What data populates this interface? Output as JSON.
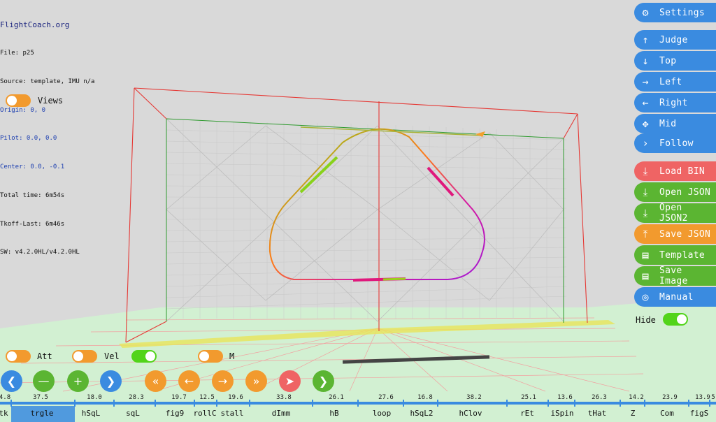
{
  "header": {
    "site": "FlightCoach.org",
    "lines": [
      "File: p25",
      "Source: template, IMU n/a",
      "Origin: 0, 0",
      "Pilot: 0.0, 0.0",
      "Center: 0.0, -0.1",
      "Total time: 6m54s",
      "Tkoff-Last: 6m46s",
      "SW: v4.2.0HL/v4.2.0HL"
    ]
  },
  "toggles": {
    "views": {
      "label": "Views",
      "state": "off"
    },
    "hide": {
      "label": "Hide",
      "state": "on"
    },
    "att": {
      "label": "Att",
      "state": "off"
    },
    "vel": {
      "label": "Vel",
      "state": "off"
    },
    "t3": {
      "label": "",
      "state": "on"
    },
    "m": {
      "label": "M",
      "state": "off"
    }
  },
  "side_buttons": [
    {
      "label": "Settings",
      "icon": "gear-icon",
      "glyph": "⚙",
      "color": "#3a8be0"
    },
    {
      "label": "Judge",
      "icon": "arrow-up-icon",
      "glyph": "↑",
      "color": "#3a8be0"
    },
    {
      "label": "Top",
      "icon": "arrow-down-icon",
      "glyph": "↓",
      "color": "#3a8be0"
    },
    {
      "label": "Left",
      "icon": "arrow-right-icon",
      "glyph": "→",
      "color": "#3a8be0"
    },
    {
      "label": "Right",
      "icon": "arrow-left-icon",
      "glyph": "←",
      "color": "#3a8be0"
    },
    {
      "label": "Mid",
      "icon": "move-icon",
      "glyph": "✥",
      "color": "#3a8be0"
    },
    {
      "label": "Follow",
      "icon": "chevron-right-icon",
      "glyph": "›",
      "color": "#3a8be0"
    },
    {
      "label": "Load BIN",
      "icon": "download-icon",
      "glyph": "⤓",
      "color": "#ef6464"
    },
    {
      "label": "Open JSON",
      "icon": "download-icon",
      "glyph": "⤓",
      "color": "#5bb532"
    },
    {
      "label": "Open JSON2",
      "icon": "download-icon",
      "glyph": "⤓",
      "color": "#5bb532"
    },
    {
      "label": "Save JSON",
      "icon": "upload-icon",
      "glyph": "⤒",
      "color": "#f29a2e"
    },
    {
      "label": "Template",
      "icon": "document-icon",
      "glyph": "▤",
      "color": "#5bb532"
    },
    {
      "label": "Save Image",
      "icon": "document-icon",
      "glyph": "▤",
      "color": "#5bb532"
    },
    {
      "label": "Manual",
      "icon": "lifebuoy-icon",
      "glyph": "◎",
      "color": "#3a8be0"
    }
  ],
  "controls": [
    {
      "name": "prev-button",
      "icon": "chevron-left-icon",
      "glyph": "❮",
      "color": "#3a8be0"
    },
    {
      "name": "zoom-out-button",
      "icon": "minus-icon",
      "glyph": "—",
      "color": "#5bb532"
    },
    {
      "name": "zoom-in-button",
      "icon": "plus-icon",
      "glyph": "+",
      "color": "#5bb532"
    },
    {
      "name": "next-button",
      "icon": "chevron-right-icon",
      "glyph": "❯",
      "color": "#3a8be0"
    },
    {
      "name": "rewind-fast-button",
      "icon": "double-chevron-left-icon",
      "glyph": "«",
      "color": "#f29a2e"
    },
    {
      "name": "step-back-button",
      "icon": "arrow-left-icon",
      "glyph": "←",
      "color": "#f29a2e"
    },
    {
      "name": "step-forward-button",
      "icon": "arrow-right-icon",
      "glyph": "→",
      "color": "#f29a2e"
    },
    {
      "name": "forward-fast-button",
      "icon": "double-chevron-right-icon",
      "glyph": "»",
      "color": "#f29a2e"
    },
    {
      "name": "send-button",
      "icon": "paper-plane-icon",
      "glyph": "➤",
      "color": "#ef6464"
    },
    {
      "name": "go-button",
      "icon": "chevron-right-icon",
      "glyph": "❯",
      "color": "#5bb532"
    }
  ],
  "timeline": {
    "durations": [
      "4.8",
      "37.5",
      "18.0",
      "28.3",
      "19.7",
      "12.5",
      "19.6",
      "33.8",
      "26.1",
      "27.6",
      "16.8",
      "38.2",
      "25.1",
      "13.6",
      "26.3",
      "14.2",
      "23.9",
      "13.9",
      "5"
    ],
    "maneuvers": [
      "tk",
      "trgle",
      "hSqL",
      "sqL",
      "fig9",
      "rollC",
      "stall",
      "dImm",
      "hB",
      "loop",
      "hSqL2",
      "hClov",
      "rEt",
      "iSpin",
      "tHat",
      "Z",
      "Com",
      "figS"
    ],
    "selected": "trgle"
  },
  "colors": {
    "accent_blue": "#3a8be0",
    "toggle_on": "#52d41a",
    "toggle_off": "#f29a2e",
    "box_red": "#e53935",
    "box_green": "#2e9a2e",
    "ground": "#d2f0d2",
    "timeline_bar": "#3a8be0"
  }
}
